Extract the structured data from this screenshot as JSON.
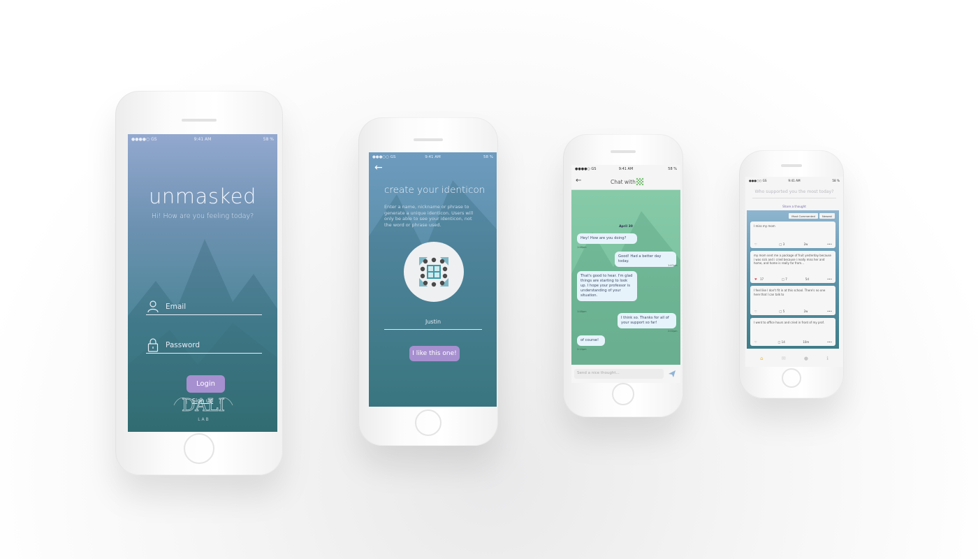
{
  "colors": {
    "accent_purple": "#a790cf",
    "login_gradient_top": "#93a8cf",
    "login_gradient_bottom": "#3a7a7e",
    "chat_green": "#80c5a3",
    "feed_gradient_top": "#8fb5cf",
    "heart_red": "#e04a5a",
    "home_active": "#e6b93a"
  },
  "login": {
    "status": {
      "carrier": "●●●●○ GS",
      "time": "9:41 AM",
      "battery": "58 %"
    },
    "title": "unmasked",
    "subtitle": "Hi! How are you feeling today?",
    "email_placeholder": "Email",
    "password_placeholder": "Password",
    "login_label": "Login",
    "signup_label": "Sign up",
    "logo_word": "DALI",
    "logo_sub": "L A B"
  },
  "identicon": {
    "status": {
      "carrier": "●●●○○ GS",
      "time": "9:41 AM",
      "battery": "58 %"
    },
    "title": "create your identicon",
    "description": "Enter a name, nickname or phrase to generate a unique identicon. Users will only be able to see your identicon, not the word or phrase used.",
    "name_value": "Justin",
    "confirm_label": "I like this one!"
  },
  "chat": {
    "status": {
      "carrier": "●●●●○ GS",
      "time": "9:41 AM",
      "battery": "58 %"
    },
    "title": "Chat with",
    "date": "April 30",
    "messages": [
      {
        "text": "Hey! How are you doing?",
        "time": "1:46pm"
      },
      {
        "text": "Good! Had a better day today.",
        "time": "1:47pm"
      },
      {
        "text": "That's good to hear. I'm glad things are starting to look up. I hope your professor is understanding of your situation.",
        "time": "1:48pm"
      },
      {
        "text": "I think so. Thanks for all of your support so far!",
        "time": "2:02pm"
      },
      {
        "text": "of course!",
        "time": "2:10pm"
      }
    ],
    "input_placeholder": "Send a nice thought..."
  },
  "feed": {
    "status": {
      "carrier": "●●●○○ GS",
      "time": "9:41 AM",
      "battery": "58 %"
    },
    "question": "Who supported you the most today?",
    "share_label": "Share a thought",
    "sort_most": "Most Commented",
    "sort_newest": "Newest",
    "posts": [
      {
        "text": "I miss my mom",
        "likes": "",
        "comments": "3",
        "age": "2w"
      },
      {
        "text": "my mom sent me a package of fruit yesterday because i was sick and i cried because i really miss her and home, and home is really far from...",
        "likes": "17",
        "comments": "7",
        "age": "5d"
      },
      {
        "text": "I feel like I don't fit in at this school. There's no one here that I can talk to",
        "likes": "",
        "comments": "5",
        "age": "2w"
      },
      {
        "text": "I went to office hours and cried in front of my prof.",
        "likes": "",
        "comments": "14",
        "age": "10m"
      }
    ]
  }
}
